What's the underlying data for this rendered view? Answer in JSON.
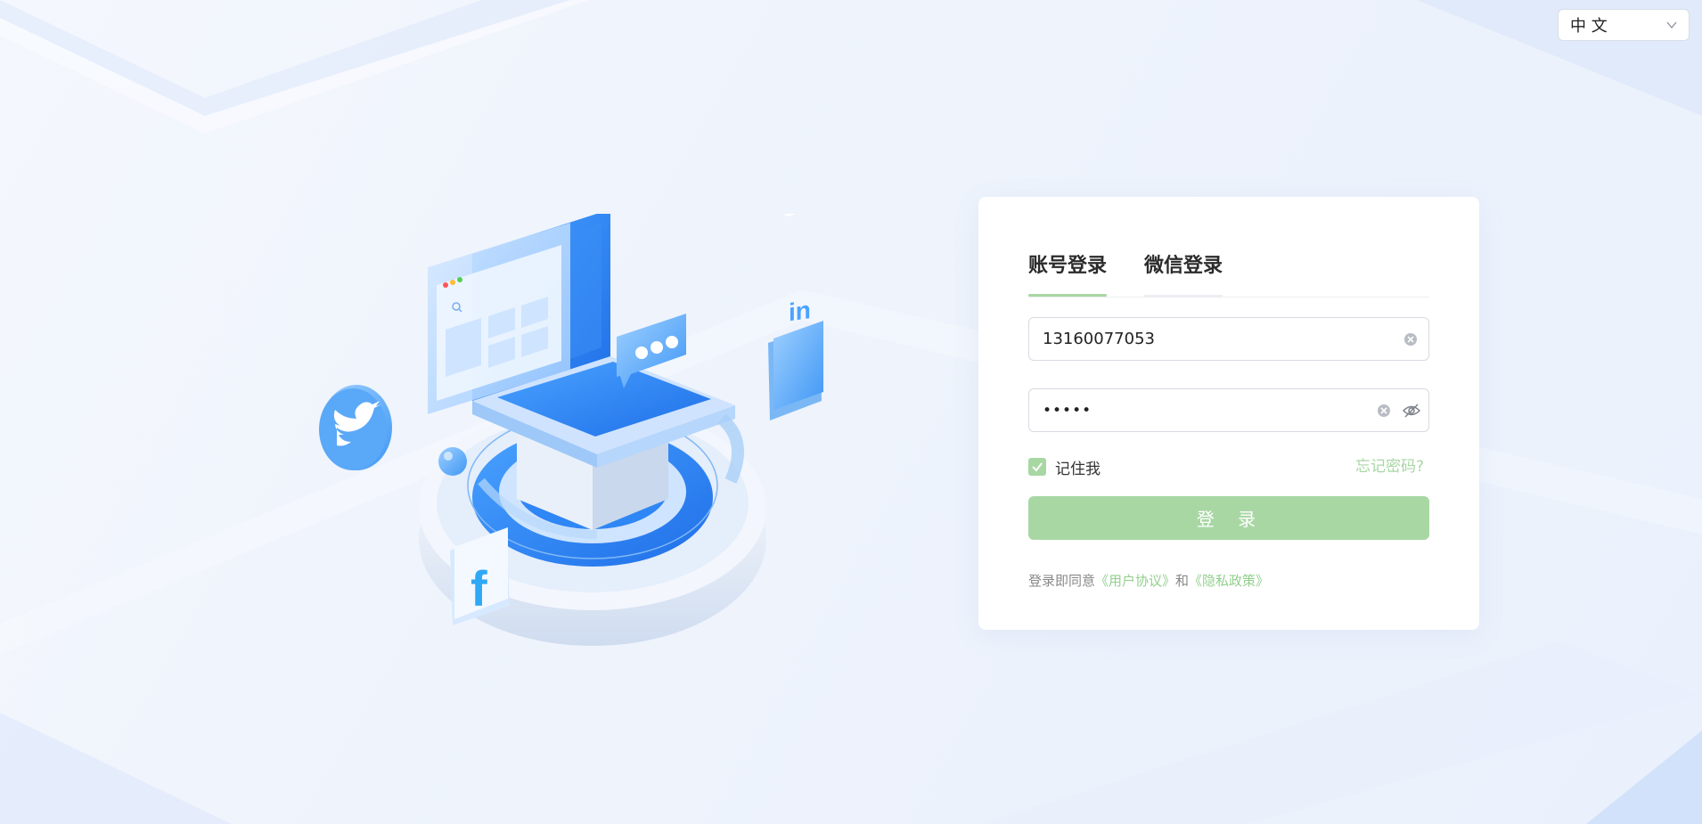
{
  "language_selector": {
    "value": "中 文",
    "icon": "chevron-down-icon"
  },
  "illustration": {
    "icons": [
      "twitter-icon",
      "facebook-icon",
      "linkedin-icon",
      "chat-bubble-icon",
      "search-icon"
    ]
  },
  "login": {
    "tabs": [
      {
        "label": "账号登录",
        "active": true
      },
      {
        "label": "微信登录",
        "active": false
      }
    ],
    "username": {
      "value": "13160077053",
      "icons": [
        "clear-icon"
      ]
    },
    "password": {
      "value": "•••••",
      "icons": [
        "clear-icon",
        "eye-off-icon"
      ]
    },
    "remember": {
      "label": "记住我",
      "checked": true
    },
    "forgot_label": "忘记密码?",
    "submit_label": "登 录",
    "agreement": {
      "prefix": "登录即同意",
      "user_agreement": "《用户协议》",
      "and": "和",
      "privacy_policy": "《隐私政策》"
    }
  },
  "colors": {
    "accent": "#a8d7a4",
    "background": "#eef3fc",
    "card": "#ffffff",
    "text": "#2b2b2b"
  }
}
